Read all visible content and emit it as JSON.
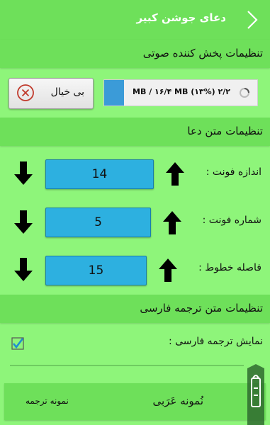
{
  "header": {
    "title": "دعای جوشن کبیر",
    "back_icon": "chevron-right-icon"
  },
  "audio_section": {
    "label": "تنظیمات پخش کننده صوتی",
    "cancel_label": "بی خیال",
    "cancel_icon": "circle-x-icon",
    "download_text": "۲/۲ MB / ۱۶/۴ MB (۱۳%)",
    "download_progress": 0.13,
    "spinner_icon": "spinner-icon"
  },
  "text_section": {
    "label": "تنظیمات متن دعا",
    "rows": [
      {
        "label": "اندازه فونت :",
        "value": "14"
      },
      {
        "label": "شماره فونت :",
        "value": "5"
      },
      {
        "label": "فاصله خطوط :",
        "value": "15"
      }
    ]
  },
  "translation_section": {
    "label": "تنظیمات متن ترجمه فارسی",
    "checkbox_label": "نمایش ترجمه فارسی :",
    "checkbox_checked": true
  },
  "sample": {
    "arabic": "نُمونه عَرَبی",
    "translation": "نمونه ترجمه"
  },
  "colors": {
    "background": "#8ef57a",
    "header": "#6ee05a",
    "value_box": "#2db0e0",
    "progress": "#3b9bd8"
  }
}
